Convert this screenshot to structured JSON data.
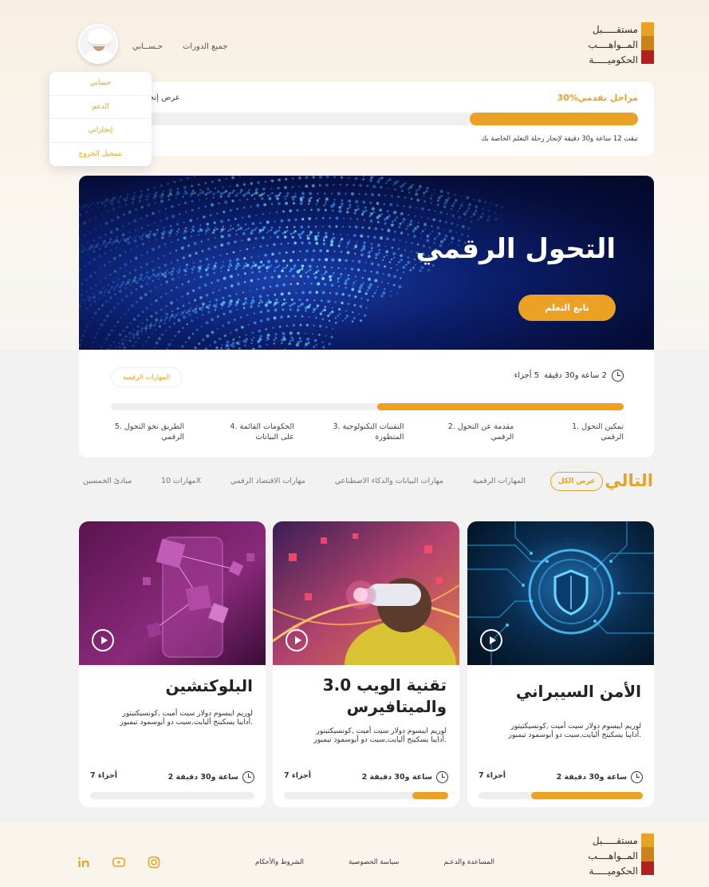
{
  "header": {
    "logo_lines": [
      "مستقـــــبل",
      "المــواهــــب",
      "الحكوميـــــة"
    ],
    "nav_all_courses": "جميع الدورات",
    "nav_account": "حـســابي"
  },
  "account_menu": {
    "items": [
      "حسابي",
      "الدعم",
      "إنجازاتي",
      "تسجيل الخروج"
    ]
  },
  "progress": {
    "title": "مراحل تقدمي",
    "percent_label": "30%",
    "percent": 0.3,
    "view_label": "عرض إنجا",
    "remaining": "تبقت 12 ساعة و30 دقيقة لإنجاز رحلة التعلم الخاصة بك"
  },
  "hero": {
    "title": "التحول الرقمي",
    "button": "تابع التعلم"
  },
  "course_info": {
    "duration": "2 ساعة و30 دقيقة",
    "parts": "5 أجزاء",
    "tag": "المهارات الرقمية",
    "progress": 0.48,
    "steps": [
      "1. تمكين التحول الرقمي",
      "2. مقدمة عن التحول الرقمي",
      "3. التقنيات التكنولوجية المتطورة",
      "4. الحكومات القائمة على البيانات",
      "5. الطريق نحو التحول الرقمي"
    ]
  },
  "next": {
    "title": "التالي",
    "view_all": "عرض الكل",
    "categories": [
      "المهارات الرقمية",
      "مهارات البيانات والذكاء الاصطناعي",
      "مهارات الاقتصاد الرقمي",
      "مهارات 10X",
      "مبادئ الخمسين"
    ]
  },
  "cards": [
    {
      "title": "الأمن السيبراني",
      "desc": "لوريم ايبسوم دولار سيت أميت ,كونسيكتيتور أدايبا يسكينج أليايت,سيت دو أيوسمود تيمبور.",
      "duration": "2 ساعة و30 دقيقة",
      "parts": "7 أجزاء",
      "progress": 0.68
    },
    {
      "title": "تقنية الويب 3.0 والميتافيرس",
      "desc": "لوريم ايبسوم دولار سيت أميت ,كونسيكتيتور أدايبا يسكينج أليايت,سيت دو أيوسمود تيمبور.",
      "duration": "2 ساعة و30 دقيقة",
      "parts": "7 أجزاء",
      "progress": 0.22
    },
    {
      "title": "البلوكتشين",
      "desc": "لوريم ايبسوم دولار سيت أميت ,كونسيكتيتور أدايبا يسكينج أليايت,سيت دو أيوسمود تيمبور.",
      "duration": "2 ساعة و30 دقيقة",
      "parts": "7 أجزاء",
      "progress": 0
    }
  ],
  "footer": {
    "links": [
      "المساعدة والدعـم",
      "سياسة الخصوصية",
      "الشروط والأحكام"
    ],
    "social_icons": [
      "instagram-icon",
      "youtube-icon",
      "linkedin-icon"
    ]
  },
  "colors": {
    "accent": "#eba123",
    "hero_dark": "#050d3a",
    "text": "#222222"
  }
}
